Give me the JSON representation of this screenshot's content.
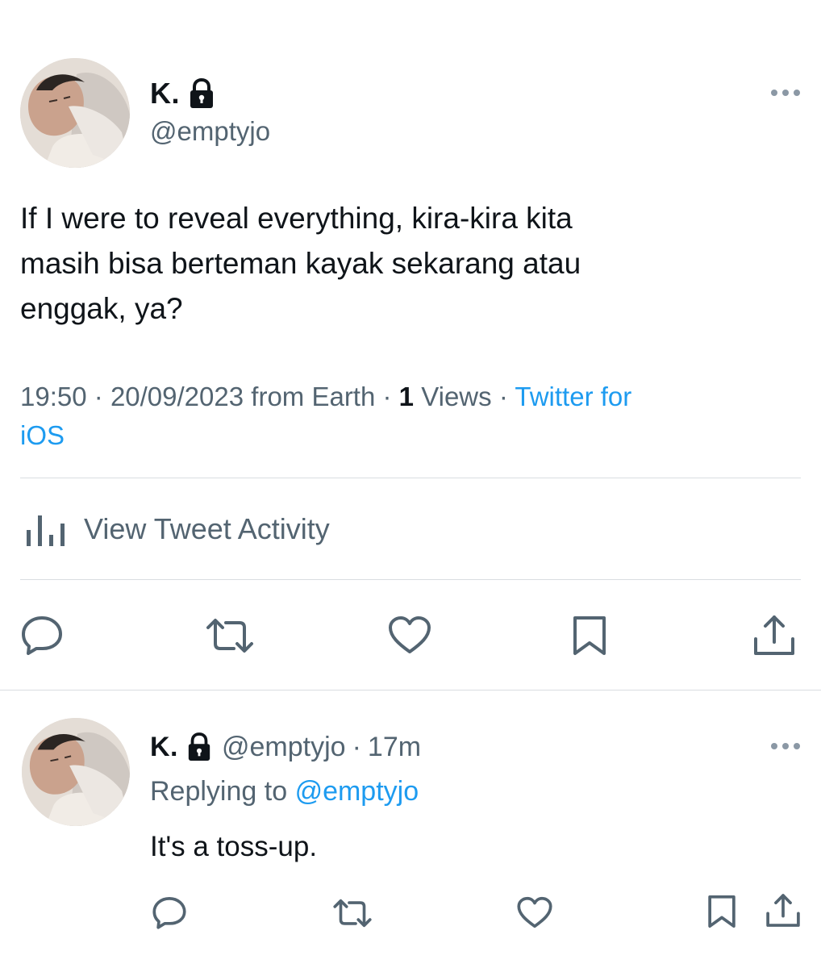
{
  "main_tweet": {
    "display_name": "K.",
    "handle": "@emptyjo",
    "text_lines": [
      "If I were to reveal everything, kira-kira kita",
      "masih bisa berteman kayak sekarang atau",
      "enggak, ya?"
    ],
    "time": "19:50",
    "separator": "·",
    "date": "20/09/2023",
    "location": "from Earth",
    "views_count": "1",
    "views_label": "Views",
    "source_line1": "Twitter for",
    "source_line2": "iOS",
    "activity_label": "View Tweet Activity",
    "icons": {
      "lock": "lock-icon",
      "more": "more-options-icon",
      "activity": "bar-chart-icon",
      "reply": "reply-icon",
      "retweet": "retweet-icon",
      "like": "heart-icon",
      "bookmark": "bookmark-icon",
      "share": "share-icon"
    }
  },
  "reply_tweet": {
    "display_name": "K.",
    "handle": "@emptyjo",
    "separator": "·",
    "time": "17m",
    "replying_to_label": "Replying to",
    "replying_to_handle": "@emptyjo",
    "text": "It's a toss-up."
  },
  "colors": {
    "primary_text": "#0f1419",
    "secondary_text": "#536471",
    "link": "#1d9bf0",
    "divider": "#d9dde1"
  }
}
